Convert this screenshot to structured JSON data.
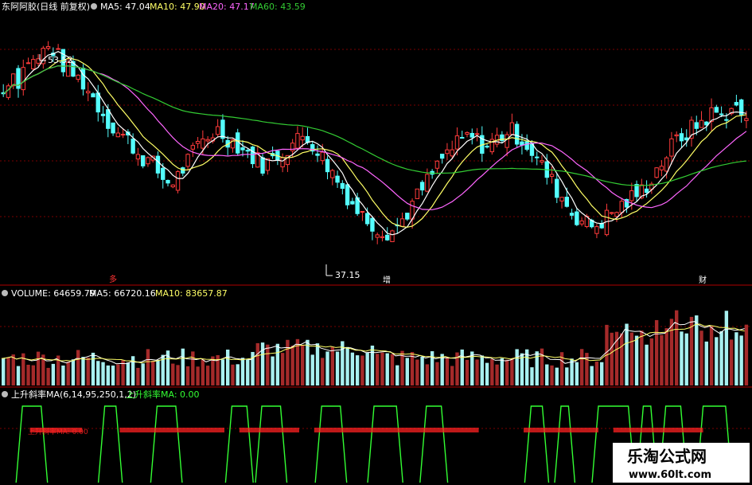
{
  "main_header": {
    "title": "东阿阿胶(日线 前复权)",
    "ma5": "MA5: 47.04",
    "ma10": "MA10: 47.90",
    "ma20": "MA20: 47.17",
    "ma60": "MA60: 43.59"
  },
  "annotations": {
    "high": "53.52",
    "low": "37.15",
    "markers": [
      "多",
      "增",
      "财"
    ]
  },
  "volume_header": {
    "label": "VOLUME: 64659.79",
    "ma5": "MA5: 66720.16",
    "ma10": "MA10: 83657.87"
  },
  "indicator_header": {
    "name": "上升斜率MA(6,14,95,250,1,2)",
    "value": "上升斜率MA: 0.00"
  },
  "watermark": {
    "name": "乐淘公式网",
    "url": "www.60lt.com"
  },
  "colors": {
    "up": "#ff3b3b",
    "down": "#54ffff",
    "ma5": "#ffffff",
    "ma10": "#ffff66",
    "ma20": "#ff66ff",
    "ma60": "#33cc33",
    "grid": "#8b0000",
    "indicator": "#33ff33",
    "indicator_text": "#ff2222"
  },
  "chart_data": [
    {
      "type": "candlestick",
      "title": "东阿阿胶(日线 前复权)",
      "close_profile": [
        49,
        51,
        50,
        52,
        51.5,
        52.5,
        53,
        52,
        51,
        50.5,
        50,
        49,
        48,
        47,
        46,
        45.5,
        45,
        44,
        43.5,
        43,
        42,
        41.5,
        42,
        43,
        44,
        45,
        45.5,
        46,
        45.5,
        45,
        44.5,
        44,
        43.5,
        43,
        43.5,
        44,
        44.5,
        45,
        45.5,
        45,
        44,
        43,
        42,
        41,
        40,
        39,
        38.5,
        38,
        37.5,
        37.5,
        38,
        39,
        40,
        41,
        42,
        43,
        44,
        44.5,
        45,
        45.5,
        45,
        44.5,
        45,
        45.5,
        46,
        45.5,
        45,
        44,
        43,
        42,
        41,
        40,
        39,
        38.5,
        38,
        38,
        38.5,
        39,
        39.5,
        40,
        40.5,
        41,
        42,
        43,
        44,
        45,
        45.5,
        46,
        46.5,
        47,
        47.5,
        47,
        48,
        47.5,
        47
      ],
      "annotated_high": 53.52,
      "annotated_low": 37.15,
      "ma_latest": {
        "MA5": 47.04,
        "MA10": 47.9,
        "MA20": 47.17,
        "MA60": 43.59
      }
    },
    {
      "type": "bar",
      "title": "VOLUME",
      "latest": {
        "VOLUME": 64659.79,
        "MA5": 66720.16,
        "MA10": 83657.87
      }
    },
    {
      "type": "line",
      "title": "上升斜率MA(6,14,95,250,1,2)",
      "latest": {
        "上升斜率MA": 0.0
      },
      "pulses": [
        [
          0.03,
          0.055
        ],
        [
          0.14,
          0.155
        ],
        [
          0.21,
          0.235
        ],
        [
          0.31,
          0.33
        ],
        [
          0.35,
          0.375
        ],
        [
          0.43,
          0.455
        ],
        [
          0.5,
          0.53
        ],
        [
          0.57,
          0.59
        ],
        [
          0.71,
          0.725
        ],
        [
          0.75,
          0.76
        ],
        [
          0.8,
          0.84
        ],
        [
          0.86,
          0.87
        ],
        [
          0.89,
          0.91
        ],
        [
          0.94,
          0.97
        ]
      ]
    }
  ]
}
